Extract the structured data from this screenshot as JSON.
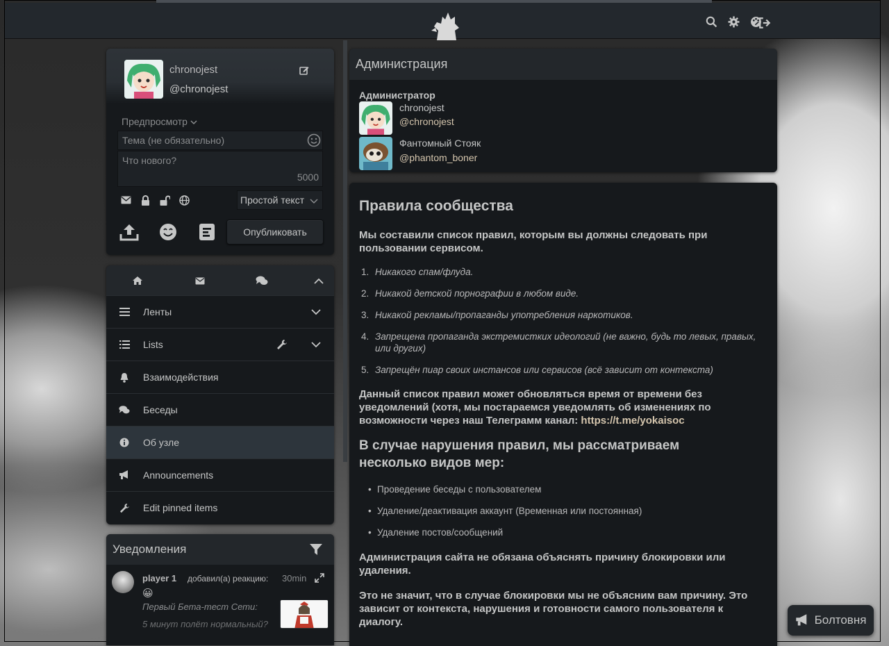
{
  "colors": {
    "accent_link": "#d4c5ad",
    "panel": "#16191c",
    "panel_head": "#23272b",
    "text": "#b9b9ba"
  },
  "topbar": {
    "icons": [
      "search-icon",
      "gear-icon",
      "palette-icon",
      "logout-icon"
    ]
  },
  "post_form": {
    "name": "chronojest",
    "handle": "@chronojest",
    "preview_label": "Предпросмотр",
    "subject_placeholder": "Тема (не обязательно)",
    "body_placeholder": "Что нового?",
    "counter": "5000",
    "format_value": "Простой текст",
    "publish_label": "Опубликовать"
  },
  "nav": {
    "items": [
      {
        "label": "Ленты",
        "icon": "bars-icon"
      },
      {
        "label": "Lists",
        "icon": "list-icon"
      },
      {
        "label": "Взаимодействия",
        "icon": "bell-icon"
      },
      {
        "label": "Беседы",
        "icon": "chats-icon"
      },
      {
        "label": "Об узле",
        "icon": "info-icon",
        "active": true
      },
      {
        "label": "Announcements",
        "icon": "megaphone-icon"
      },
      {
        "label": "Edit pinned items",
        "icon": "wrench-icon"
      }
    ]
  },
  "notifications": {
    "title": "Уведомления",
    "items": [
      {
        "user": "player 1",
        "action": "добавил(а) реакцию:",
        "time": "30min",
        "emoji": "😀",
        "post_line1": "Первый Бета-тест Сети:",
        "post_line2": "5 минут полёт нормальный?"
      }
    ]
  },
  "admin": {
    "title": "Администрация",
    "role": "Администратор",
    "members": [
      {
        "name": "chronojest",
        "handle": "@chronojest"
      },
      {
        "name": "Фантомный Стояк",
        "handle": "@phantom_boner"
      }
    ]
  },
  "rules": {
    "heading": "Правила сообщества",
    "intro": "Мы составили список правил, которым вы должны следовать при пользовании сервисом.",
    "list": [
      "Никакого спам/флуда.",
      "Никакой детской порнографии в любом виде.",
      "Никакой рекламы/пропаганды употребления наркотиков.",
      "Запрещена пропаганда экстремистких идеологий (не важно, будь то левых, правых, или других)",
      "Запрещён пиар своих инстансов или сервисов (всё зависит от контекста)"
    ],
    "update_text": "Данный список правил может обновляться время от времени без уведомлений (хотя, мы постараемся уведомлять об изменениях по возможности через наш Телеграмм канал: ",
    "update_link": "https://t.me/yokaisoc",
    "measures_heading": "В случае нарушения правил, мы рассматриваем несколько видов мер:",
    "measures": [
      "Проведение беседы с пользователем",
      "Удаление/деактивация аккаунт (Временная или постоянная)",
      "Удаление постов/сообщений"
    ],
    "p_no_explain": "Администрация сайта не обязана объяснять причину блокировки или удаления.",
    "p_context": "Это не значит, что в случае блокировки мы не объясним вам причину. Это зависит от контекста, нарушения и готовности самого пользователя к диалогу."
  },
  "chat": {
    "label": "Болтовня"
  }
}
